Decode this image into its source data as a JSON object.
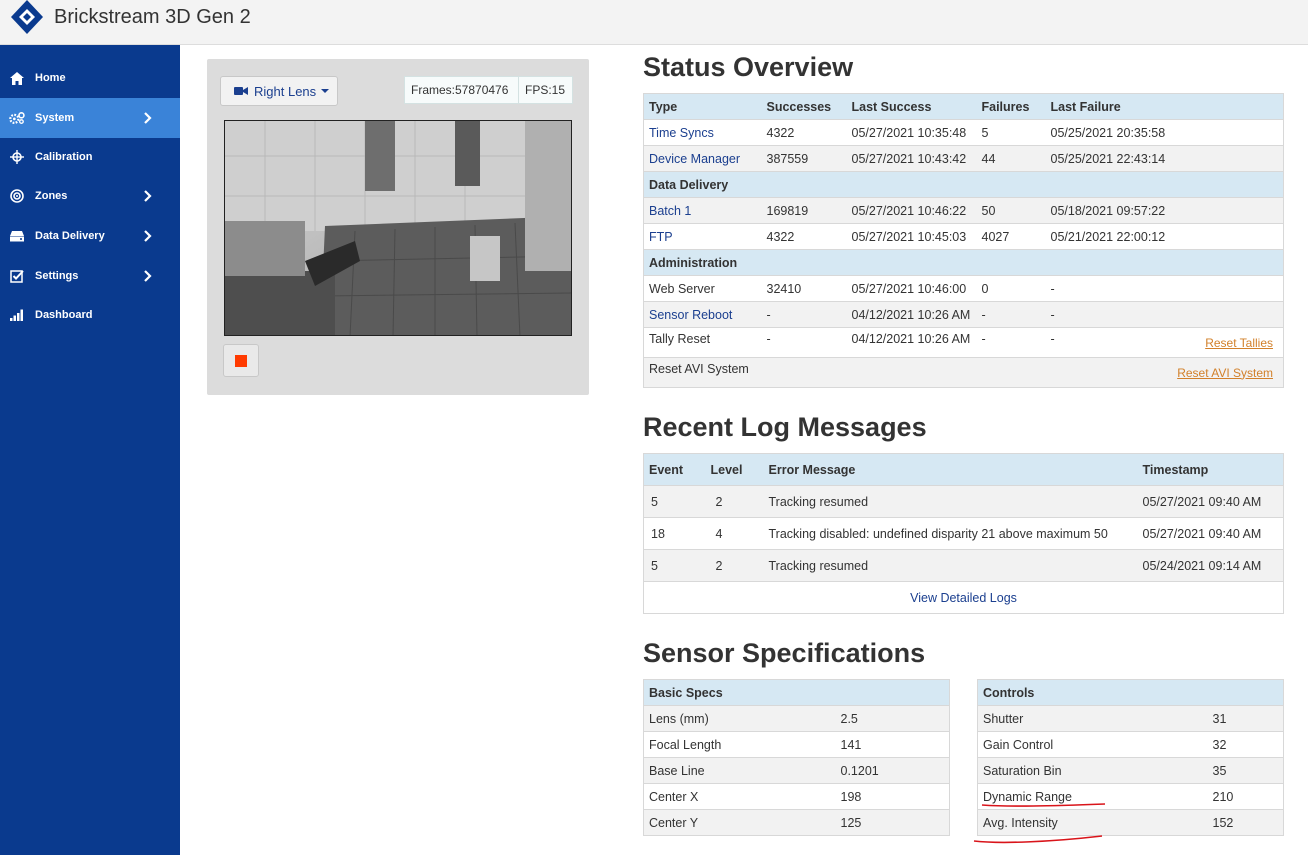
{
  "app": {
    "title": "Brickstream 3D Gen 2"
  },
  "sidebar": {
    "items": [
      {
        "label": "Home",
        "icon": "home-icon",
        "active": false,
        "has_chevron": false
      },
      {
        "label": "System",
        "icon": "gears-icon",
        "active": true,
        "has_chevron": true
      },
      {
        "label": "Calibration",
        "icon": "crosshair-icon",
        "active": false,
        "has_chevron": false
      },
      {
        "label": "Zones",
        "icon": "target-icon",
        "active": false,
        "has_chevron": true
      },
      {
        "label": "Data Delivery",
        "icon": "drive-icon",
        "active": false,
        "has_chevron": true
      },
      {
        "label": "Settings",
        "icon": "checkbox-icon",
        "active": false,
        "has_chevron": true
      },
      {
        "label": "Dashboard",
        "icon": "signal-bars-icon",
        "active": false,
        "has_chevron": false
      }
    ]
  },
  "viewer": {
    "lens_label": "Right Lens",
    "frames": "Frames:57870476",
    "fps": "FPS:15"
  },
  "status": {
    "heading": "Status Overview",
    "columns": [
      "Type",
      "Successes",
      "Last Success",
      "Failures",
      "Last Failure"
    ],
    "rows_a": [
      {
        "type": "Time Syncs",
        "successes": "4322",
        "last_success": "05/27/2021 10:35:48",
        "failures": "5",
        "last_failure": "05/25/2021 20:35:58"
      },
      {
        "type": "Device Manager",
        "successes": "387559",
        "last_success": "05/27/2021 10:43:42",
        "failures": "44",
        "last_failure": "05/25/2021 22:43:14"
      }
    ],
    "group_data_delivery": "Data Delivery",
    "rows_b": [
      {
        "type": "Batch 1",
        "successes": "169819",
        "last_success": "05/27/2021 10:46:22",
        "failures": "50",
        "last_failure": "05/18/2021 09:57:22"
      },
      {
        "type": "FTP",
        "successes": "4322",
        "last_success": "05/27/2021 10:45:03",
        "failures": "4027",
        "last_failure": "05/21/2021 22:00:12"
      }
    ],
    "group_administration": "Administration",
    "rows_c": [
      {
        "type": "Web Server",
        "successes": "32410",
        "last_success": "05/27/2021 10:46:00",
        "failures": "0",
        "last_failure": "-"
      },
      {
        "type": "Sensor Reboot",
        "successes": "-",
        "last_success": "04/12/2021 10:26 AM",
        "failures": "-",
        "last_failure": "-"
      },
      {
        "type": "Tally Reset",
        "successes": "-",
        "last_success": "04/12/2021 10:26 AM",
        "failures": "-",
        "last_failure": "-"
      }
    ],
    "reset_tallies": "Reset Tallies",
    "reset_avi_label": "Reset AVI System",
    "reset_avi_link": "Reset AVI System"
  },
  "logs": {
    "heading": "Recent Log Messages",
    "columns": [
      "Event",
      "Level",
      "Error Message",
      "Timestamp"
    ],
    "rows": [
      {
        "event": "5",
        "level": "2",
        "message": "Tracking resumed",
        "timestamp": "05/27/2021 09:40 AM"
      },
      {
        "event": "18",
        "level": "4",
        "message": "Tracking disabled: undefined disparity 21 above maximum 50",
        "timestamp": "05/27/2021 09:40 AM"
      },
      {
        "event": "5",
        "level": "2",
        "message": "Tracking resumed",
        "timestamp": "05/24/2021 09:14 AM"
      }
    ],
    "view_link": "View Detailed Logs"
  },
  "specs": {
    "heading": "Sensor Specifications",
    "basic": {
      "header": "Basic Specs",
      "rows": [
        {
          "label": "Lens (mm)",
          "value": "2.5"
        },
        {
          "label": "Focal Length",
          "value": "141"
        },
        {
          "label": "Base Line",
          "value": "0.1201"
        },
        {
          "label": "Center X",
          "value": "198"
        },
        {
          "label": "Center Y",
          "value": "125"
        }
      ]
    },
    "controls": {
      "header": "Controls",
      "rows": [
        {
          "label": "Shutter",
          "value": "31"
        },
        {
          "label": "Gain Control",
          "value": "32"
        },
        {
          "label": "Saturation Bin",
          "value": "35"
        },
        {
          "label": "Dynamic Range",
          "value": "210"
        },
        {
          "label": "Avg. Intensity",
          "value": "152"
        }
      ]
    }
  },
  "colors": {
    "sidebar": "#0a3a8e",
    "active": "#3a83d8",
    "table_header": "#d6e8f3",
    "link": "#1b3f8f",
    "orange_link": "#d2802a",
    "annotation": "#d9141a"
  }
}
